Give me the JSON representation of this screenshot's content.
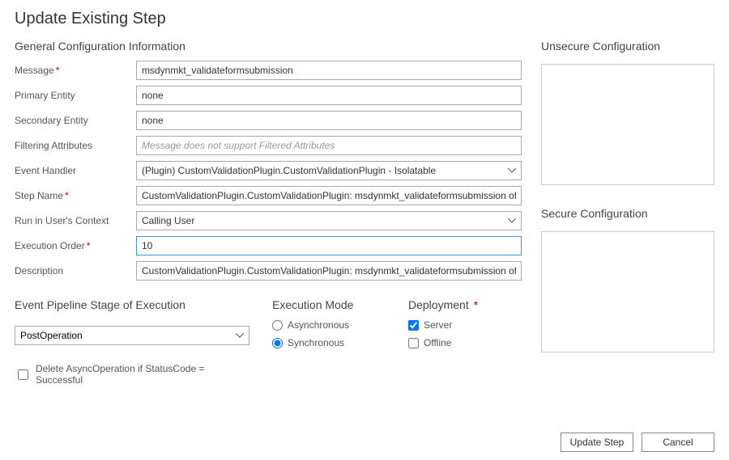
{
  "title": "Update Existing Step",
  "general": {
    "heading": "General Configuration Information",
    "message_label": "Message",
    "message_value": "msdynmkt_validateformsubmission",
    "primary_label": "Primary Entity",
    "primary_value": "none",
    "secondary_label": "Secondary Entity",
    "secondary_value": "none",
    "filtering_label": "Filtering Attributes",
    "filtering_placeholder": "Message does not support Filtered Attributes",
    "handler_label": "Event Handler",
    "handler_value": "(Plugin) CustomValidationPlugin.CustomValidationPlugin - Isolatable",
    "stepname_label": "Step Name",
    "stepname_value": "CustomValidationPlugin.CustomValidationPlugin: msdynmkt_validateformsubmission of any Ent",
    "context_label": "Run in User's Context",
    "context_value": "Calling User",
    "order_label": "Execution Order",
    "order_value": "10",
    "desc_label": "Description",
    "desc_value": "CustomValidationPlugin.CustomValidationPlugin: msdynmkt_validateformsubmission of any Ent"
  },
  "pipeline": {
    "heading": "Event Pipeline Stage of Execution",
    "value": "PostOperation"
  },
  "exec_mode": {
    "heading": "Execution Mode",
    "async_label": "Asynchronous",
    "sync_label": "Synchronous",
    "selected": "sync"
  },
  "deployment": {
    "heading": "Deployment",
    "server_label": "Server",
    "offline_label": "Offline",
    "server_checked": true,
    "offline_checked": false
  },
  "delete_async_label": "Delete AsyncOperation if StatusCode = Successful",
  "unsecure_heading": "Unsecure  Configuration",
  "secure_heading": "Secure  Configuration",
  "footer": {
    "update": "Update Step",
    "cancel": "Cancel"
  }
}
